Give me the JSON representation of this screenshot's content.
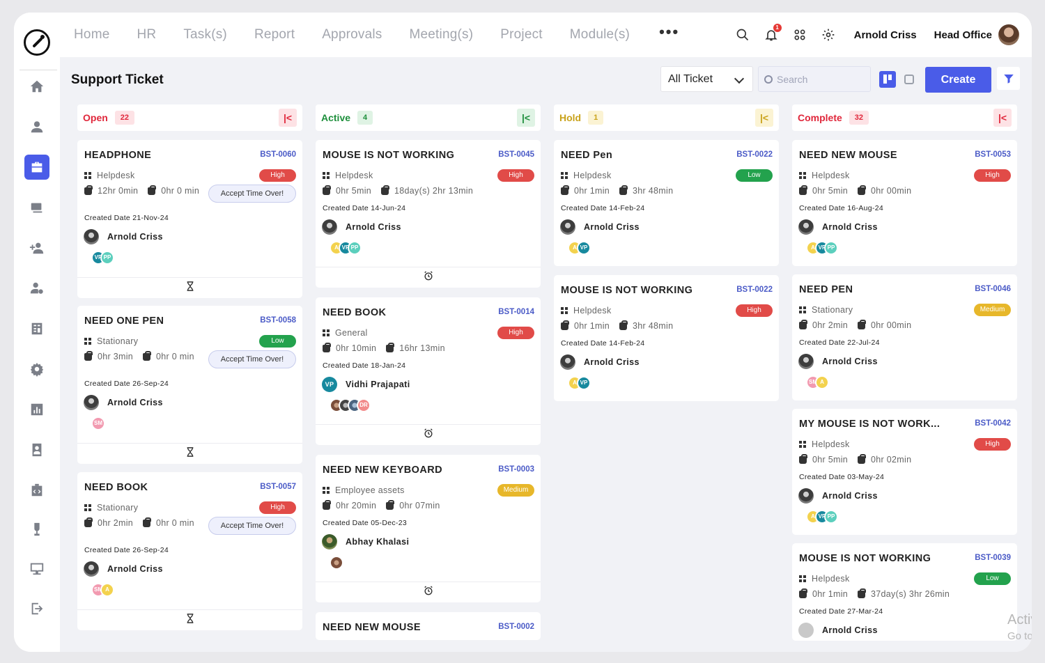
{
  "nav": {
    "items": [
      "Home",
      "HR",
      "Task(s)",
      "Report",
      "Approvals",
      "Meeting(s)",
      "Project",
      "Module(s)"
    ],
    "more": "•••"
  },
  "header": {
    "notification_count": "1",
    "user_name": "Arnold Criss",
    "office": "Head Office"
  },
  "page": {
    "title": "Support Ticket",
    "filter_value": "All Ticket",
    "search_placeholder": "Search",
    "create_label": "Create"
  },
  "colors": {
    "accent": "#4a5ce8",
    "high": "#e14b48",
    "low": "#23a24d",
    "medium": "#e7b72a"
  },
  "columns": [
    {
      "title": "Open",
      "count": "22",
      "cards": [
        {
          "title": "HEADPHONE",
          "id": "BST-0060",
          "category": "Helpdesk",
          "priority": "High",
          "time1": "12hr 0min",
          "time2": "0hr 0 min",
          "action": "Accept Time Over!",
          "created": "Created Date 21-Nov-24",
          "assignee": "Arnold Criss",
          "bubbles": [
            "VP",
            "PP"
          ]
        },
        {
          "title": "NEED ONE PEN",
          "id": "BST-0058",
          "category": "Stationary",
          "priority": "Low",
          "time1": "0hr 3min",
          "time2": "0hr 0 min",
          "action": "Accept Time Over!",
          "created": "Created Date 26-Sep-24",
          "assignee": "Arnold Criss",
          "bubbles": [
            "SM"
          ]
        },
        {
          "title": "NEED BOOK",
          "id": "BST-0057",
          "category": "Stationary",
          "priority": "High",
          "time1": "0hr 2min",
          "time2": "0hr 0 min",
          "action": "Accept Time Over!",
          "created": "Created Date 26-Sep-24",
          "assignee": "Arnold Criss",
          "bubbles": [
            "SM",
            "A"
          ]
        }
      ]
    },
    {
      "title": "Active",
      "count": "4",
      "cards": [
        {
          "title": "MOUSE IS NOT WORKING",
          "id": "BST-0045",
          "category": "Helpdesk",
          "priority": "High",
          "time1": "0hr 5min",
          "time2": "18day(s) 2hr 13min",
          "created": "Created Date 14-Jun-24",
          "assignee": "Arnold Criss",
          "bubbles": [
            "A",
            "VP",
            "PP"
          ]
        },
        {
          "title": "NEED BOOK",
          "id": "BST-0014",
          "category": "General",
          "priority": "High",
          "time1": "0hr 10min",
          "time2": "16hr 13min",
          "created": "Created Date 18-Jan-24",
          "assignee": "Vidhi Prajapati",
          "assignee_initials": "VP",
          "bubbles": [
            "",
            "",
            "",
            "DR"
          ]
        },
        {
          "title": "NEED NEW KEYBOARD",
          "id": "BST-0003",
          "category": "Employee assets",
          "priority": "Medium",
          "time1": "0hr 20min",
          "time2": "0hr 07min",
          "created": "Created Date 05-Dec-23",
          "assignee": "Abhay Khalasi",
          "bubbles": [
            ""
          ]
        },
        {
          "title": "NEED NEW MOUSE",
          "id": "BST-0002"
        }
      ]
    },
    {
      "title": "Hold",
      "count": "1",
      "cards": [
        {
          "title": "NEED Pen",
          "id": "BST-0022",
          "category": "Helpdesk",
          "priority": "Low",
          "time1": "0hr 1min",
          "time2": "3hr 48min",
          "created": "Created Date 14-Feb-24",
          "assignee": "Arnold Criss",
          "bubbles": [
            "A",
            "VP"
          ]
        },
        {
          "title": "MOUSE IS NOT WORKING",
          "id": "BST-0022",
          "category": "Helpdesk",
          "priority": "High",
          "time1": "0hr 1min",
          "time2": "3hr 48min",
          "created": "Created Date 14-Feb-24",
          "assignee": "Arnold Criss",
          "bubbles": [
            "A",
            "VP"
          ]
        }
      ]
    },
    {
      "title": "Complete",
      "count": "32",
      "cards": [
        {
          "title": "NEED NEW MOUSE",
          "id": "BST-0053",
          "category": "Helpdesk",
          "priority": "High",
          "time1": "0hr 5min",
          "time2": "0hr 00min",
          "created": "Created Date 16-Aug-24",
          "assignee": "Arnold Criss",
          "bubbles": [
            "A",
            "VP",
            "PP"
          ]
        },
        {
          "title": "NEED PEN",
          "id": "BST-0046",
          "category": "Stationary",
          "priority": "Medium",
          "time1": "0hr 2min",
          "time2": "0hr 00min",
          "created": "Created Date 22-Jul-24",
          "assignee": "Arnold Criss",
          "bubbles": [
            "SM",
            "A"
          ]
        },
        {
          "title": "MY MOUSE IS NOT WORK...",
          "id": "BST-0042",
          "category": "Helpdesk",
          "priority": "High",
          "time1": "0hr 5min",
          "time2": "0hr 02min",
          "created": "Created Date 03-May-24",
          "assignee": "Arnold Criss",
          "bubbles": [
            "A",
            "VP",
            "PP"
          ]
        },
        {
          "title": "MOUSE IS NOT WORKING",
          "id": "BST-0039",
          "category": "Helpdesk",
          "priority": "Low",
          "time1": "0hr 1min",
          "time2": "37day(s) 3hr 26min",
          "created": "Created Date 27-Mar-24",
          "assignee": "Arnold Criss"
        }
      ]
    }
  ],
  "watermark": {
    "line1": "Activate",
    "line2": "Go to Setti"
  }
}
